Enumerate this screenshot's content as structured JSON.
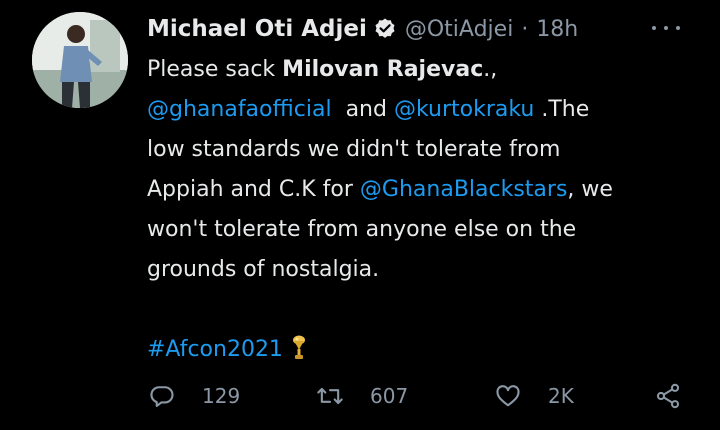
{
  "tweet": {
    "author": {
      "display_name": "Michael Oti Adjei",
      "handle": "@OtiAdjei",
      "verified_icon": "verified-badge-icon"
    },
    "separator": "·",
    "time": "18h",
    "more_icon": "more-options-icon",
    "lines": [
      {
        "p1": "Please sack ",
        "b1": "Milovan Rajevac",
        "p2": "., "
      },
      {
        "m1": "@ghanafaofficial",
        "p1": "  and ",
        "m2": "@kurtokraku",
        "p2": " .The"
      },
      {
        "p1": "low standards we didn't tolerate from"
      },
      {
        "p1": "Appiah and C.K for ",
        "m1": "@GhanaBlackstars",
        "p2": ", we"
      },
      {
        "p1": "won't tolerate from anyone else on the"
      },
      {
        "p1": "grounds of nostalgia."
      },
      {
        "h1": "#Afcon2021",
        "emoji": "trophy-icon"
      }
    ],
    "actions": {
      "replies": "129",
      "retweets": "607",
      "likes": "2K"
    },
    "colors": {
      "background": "#000000",
      "text": "#e7e9ea",
      "secondary": "#8b98a5",
      "link": "#1d9bf0"
    }
  }
}
